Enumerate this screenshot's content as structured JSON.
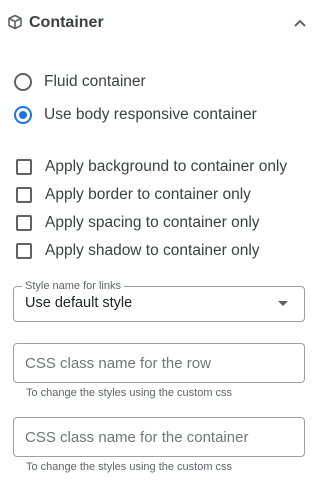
{
  "header": {
    "title": "Container",
    "icon": "cube-icon",
    "collapse_icon": "chevron-up-icon"
  },
  "container_type": {
    "options": [
      "Fluid container",
      "Use body responsive container"
    ],
    "selected": "Use body responsive container"
  },
  "checkboxes": [
    {
      "label": "Apply background to container only",
      "checked": false
    },
    {
      "label": "Apply border to container only",
      "checked": false
    },
    {
      "label": "Apply spacing to container only",
      "checked": false
    },
    {
      "label": "Apply shadow to container only",
      "checked": false
    }
  ],
  "style_select": {
    "label": "Style name for links",
    "value": "Use default style"
  },
  "row_class": {
    "placeholder": "CSS class name for the row",
    "value": "",
    "helper": "To change the styles using the custom css"
  },
  "container_class": {
    "placeholder": "CSS class name for the container",
    "value": "",
    "helper": "To change the styles using the custom css"
  },
  "colors": {
    "accent": "#1a73e8",
    "text": "#3c4043",
    "border": "#9e9e9e"
  }
}
